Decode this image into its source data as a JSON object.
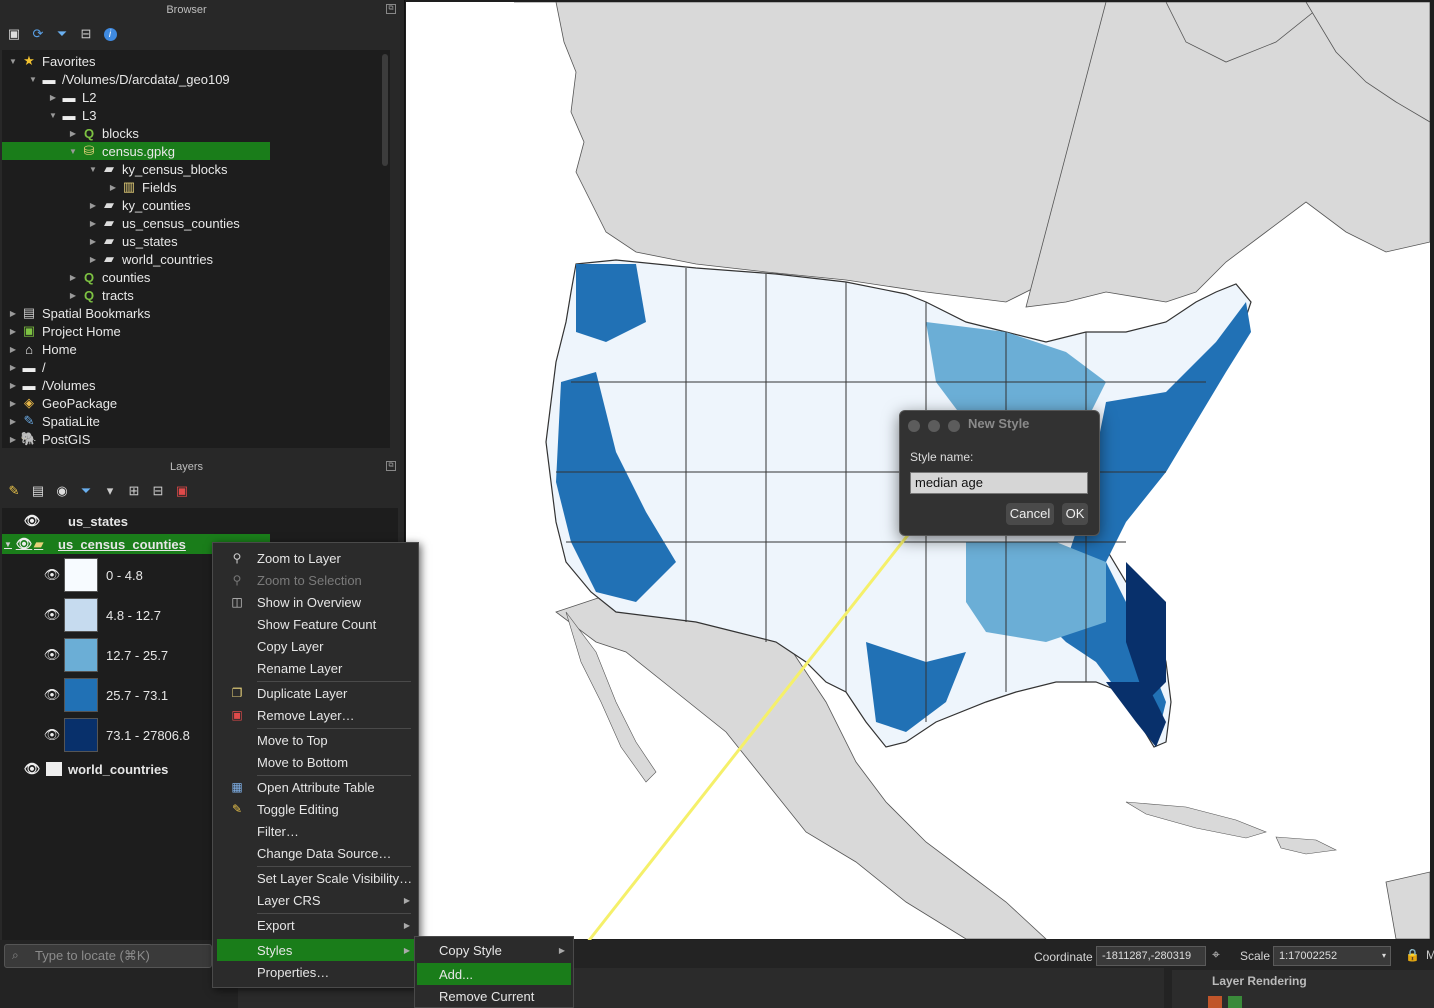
{
  "browser": {
    "title": "Browser",
    "tree": [
      {
        "label": "Favorites",
        "icon": "star-icon"
      },
      {
        "label": "/Volumes/D/arcdata/_geo109",
        "icon": "folder-icon"
      },
      {
        "label": "L2",
        "icon": "folder-icon"
      },
      {
        "label": "L3",
        "icon": "folder-icon"
      },
      {
        "label": "blocks",
        "icon": "qgis-project-icon"
      },
      {
        "label": "census.gpkg",
        "icon": "geopackage-icon"
      },
      {
        "label": "ky_census_blocks",
        "icon": "polygon-layer-icon"
      },
      {
        "label": "Fields",
        "icon": "fields-icon"
      },
      {
        "label": "ky_counties",
        "icon": "polygon-layer-icon"
      },
      {
        "label": "us_census_counties",
        "icon": "polygon-layer-icon"
      },
      {
        "label": "us_states",
        "icon": "polygon-layer-icon"
      },
      {
        "label": "world_countries",
        "icon": "polygon-layer-icon"
      },
      {
        "label": "counties",
        "icon": "qgis-project-icon"
      },
      {
        "label": "tracts",
        "icon": "qgis-project-icon"
      },
      {
        "label": "Spatial Bookmarks",
        "icon": "bookmark-icon"
      },
      {
        "label": "Project Home",
        "icon": "project-home-icon"
      },
      {
        "label": "Home",
        "icon": "home-icon"
      },
      {
        "label": "/",
        "icon": "folder-icon"
      },
      {
        "label": "/Volumes",
        "icon": "folder-icon"
      },
      {
        "label": "GeoPackage",
        "icon": "geopackage-icon"
      },
      {
        "label": "SpatiaLite",
        "icon": "spatialite-icon"
      },
      {
        "label": "PostGIS",
        "icon": "postgis-icon"
      }
    ]
  },
  "layers": {
    "title": "Layers",
    "items": [
      {
        "label": "us_states"
      },
      {
        "label": "us_census_counties"
      },
      {
        "label": "0 - 4.8",
        "color": "#f7fbff"
      },
      {
        "label": "4.8 - 12.7",
        "color": "#c6dbef"
      },
      {
        "label": "12.7 - 25.7",
        "color": "#6baed6"
      },
      {
        "label": "25.7 - 73.1",
        "color": "#2171b5"
      },
      {
        "label": "73.1 - 27806.8",
        "color": "#08306b"
      },
      {
        "label": "world_countries"
      }
    ]
  },
  "context_menu": {
    "items": [
      {
        "label": "Zoom to Layer"
      },
      {
        "label": "Zoom to Selection"
      },
      {
        "label": "Show in Overview"
      },
      {
        "label": "Show Feature Count"
      },
      {
        "label": "Copy Layer"
      },
      {
        "label": "Rename Layer"
      },
      {
        "label": "Duplicate Layer"
      },
      {
        "label": "Remove Layer…"
      },
      {
        "label": "Move to Top"
      },
      {
        "label": "Move to Bottom"
      },
      {
        "label": "Open Attribute Table"
      },
      {
        "label": "Toggle Editing"
      },
      {
        "label": "Filter…"
      },
      {
        "label": "Change Data Source…"
      },
      {
        "label": "Set Layer Scale Visibility…"
      },
      {
        "label": "Layer CRS"
      },
      {
        "label": "Export"
      },
      {
        "label": "Styles"
      },
      {
        "label": "Properties…"
      }
    ]
  },
  "styles_submenu": {
    "items": [
      {
        "label": "Copy Style"
      },
      {
        "label": "Add..."
      },
      {
        "label": "Remove Current"
      }
    ]
  },
  "dialog": {
    "title": "New Style",
    "field_label": "Style name:",
    "field_value": "median age",
    "cancel": "Cancel",
    "ok": "OK"
  },
  "statusbar": {
    "locator_placeholder": "Type to locate (⌘K)",
    "coordinate_label": "Coordinate",
    "coordinate_value": "-1811287,-280319",
    "scale_label": "Scale",
    "scale_value": "1:17002252",
    "rendering_label": "Layer Rendering"
  },
  "colors": {
    "selection": "#1a7d1a",
    "map_land": "#d9d9d9",
    "map_water": "#ffffff",
    "arrow": "#f5f06a"
  }
}
